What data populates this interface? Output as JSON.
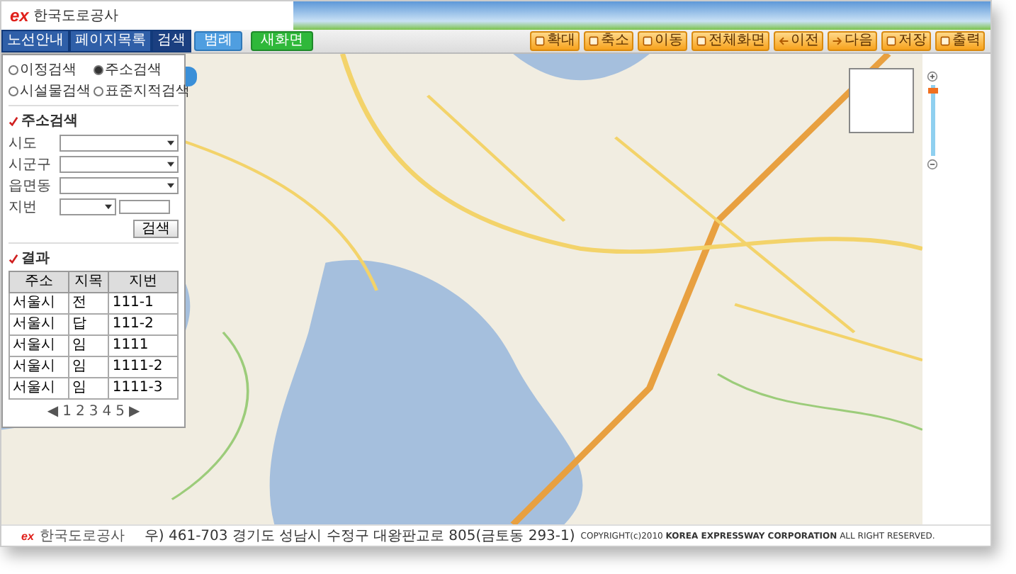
{
  "header": {
    "logo_mark": "ex",
    "logo_text": "한국도로공사"
  },
  "panel_tabs": [
    {
      "label": "노선안내",
      "selected": false
    },
    {
      "label": "페이지목록",
      "selected": false
    },
    {
      "label": "검색",
      "selected": true
    }
  ],
  "view_buttons": [
    {
      "label": "범례",
      "kind": "blue"
    },
    {
      "label": "새화면",
      "kind": "green"
    }
  ],
  "tools": [
    {
      "label": "확대",
      "kind": "plain"
    },
    {
      "label": "축소",
      "kind": "plain"
    },
    {
      "label": "이동",
      "kind": "plain"
    },
    {
      "label": "전체화면",
      "kind": "plain"
    },
    {
      "label": "이전",
      "kind": "back"
    },
    {
      "label": "다음",
      "kind": "forward"
    },
    {
      "label": "저장",
      "kind": "plain"
    },
    {
      "label": "출력",
      "kind": "plain"
    }
  ],
  "search_types": [
    {
      "label": "이정검색",
      "selected": false
    },
    {
      "label": "주소검색",
      "selected": true
    },
    {
      "label": "시설물검색",
      "selected": false
    },
    {
      "label": "표준지적검색",
      "selected": false
    }
  ],
  "address_search": {
    "title": "주소검색",
    "fields": [
      {
        "label": "시도"
      },
      {
        "label": "시군구"
      },
      {
        "label": "읍면동"
      }
    ],
    "lot_label": "지번",
    "button": "검색"
  },
  "results": {
    "title": "결과",
    "columns": [
      "주소",
      "지목",
      "지번"
    ],
    "rows": [
      [
        "서울시",
        "전",
        "111-1"
      ],
      [
        "서울시",
        "답",
        "111-2"
      ],
      [
        "서울시",
        "임",
        "1111"
      ],
      [
        "서울시",
        "임",
        "1111-2"
      ],
      [
        "서울시",
        "임",
        "1111-3"
      ]
    ],
    "pages": [
      "1",
      "2",
      "3",
      "4",
      "5"
    ],
    "prev": "◀",
    "next": "▶"
  },
  "zoom": {
    "level": 0.92
  },
  "footer": {
    "logo_mark": "ex",
    "logo_text": "한국도로공사",
    "address": "우) 461-703 경기도 성남시 수정구 대왕판교로 805(금토동 293-1)",
    "copyright": "COPYRIGHT(c)2010 **KOREA EXPRESSWAY CORPORATION** ALL RIGHT RESERVED."
  }
}
